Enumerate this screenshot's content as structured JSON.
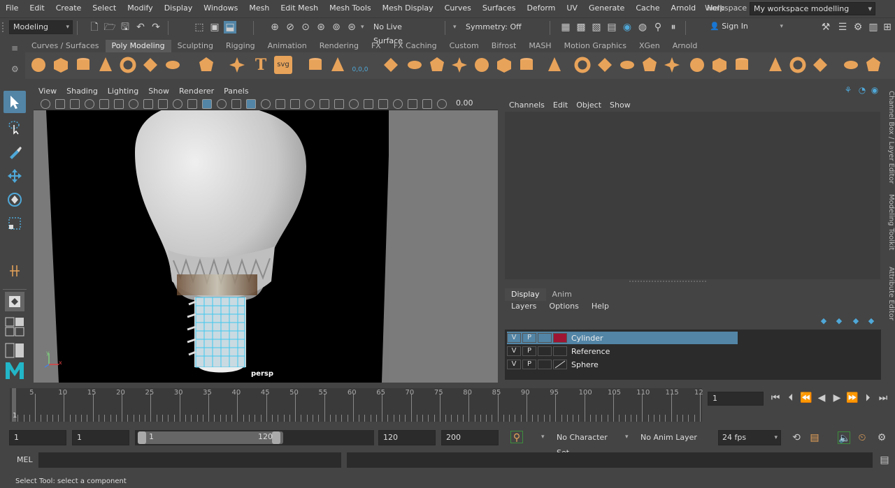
{
  "menu": [
    "File",
    "Edit",
    "Create",
    "Select",
    "Modify",
    "Display",
    "Windows",
    "Mesh",
    "Edit Mesh",
    "Mesh Tools",
    "Mesh Display",
    "Curves",
    "Surfaces",
    "Deform",
    "UV",
    "Generate",
    "Cache",
    "Arnold",
    "Help"
  ],
  "workspace": {
    "label": "Workspace :",
    "value": "My workspace modelling"
  },
  "statusline": {
    "menuset": "Modeling",
    "live_surface": "No Live Surface",
    "symmetry": "Symmetry: Off",
    "sign_in": "Sign In"
  },
  "shelf_tabs": [
    "Curves / Surfaces",
    "Poly Modeling",
    "Sculpting",
    "Rigging",
    "Animation",
    "Rendering",
    "FX",
    "FX Caching",
    "Custom",
    "Bifrost",
    "MASH",
    "Motion Graphics",
    "XGen",
    "Arnold"
  ],
  "shelf_active": "Poly Modeling",
  "shelf_text_icons": {
    "text_tool": "T",
    "svg_tool": "svg",
    "coords": "0,0,0"
  },
  "viewport": {
    "menus": [
      "View",
      "Shading",
      "Lighting",
      "Show",
      "Renderer",
      "Panels"
    ],
    "value_field": "0.00",
    "camera_label": "persp",
    "axis_y": "y",
    "axis_x": "x"
  },
  "channel_box": {
    "menus": [
      "Channels",
      "Edit",
      "Object",
      "Show"
    ]
  },
  "side_tabs": [
    "Channel Box / Layer Editor",
    "Modeling Toolkit",
    "Attribute Editor"
  ],
  "layer_editor": {
    "tabs": [
      "Display",
      "Anim"
    ],
    "menus": [
      "Layers",
      "Options",
      "Help"
    ],
    "layers": [
      {
        "v": "V",
        "p": "P",
        "name": "Cylinder",
        "color": "#9e1533",
        "selected": true
      },
      {
        "v": "V",
        "p": "P",
        "name": "Reference",
        "color": "",
        "selected": false
      },
      {
        "v": "V",
        "p": "P",
        "name": "Sphere",
        "color": "",
        "selected": false
      }
    ]
  },
  "timeline": {
    "ticks": [
      "5",
      "10",
      "15",
      "20",
      "25",
      "30",
      "35",
      "40",
      "45",
      "50",
      "55",
      "60",
      "65",
      "70",
      "75",
      "80",
      "85",
      "90",
      "95",
      "100",
      "105",
      "110",
      "115",
      "12"
    ],
    "current_frame_marker": "1",
    "current_frame": "1"
  },
  "range": {
    "start": "1",
    "playback_start": "1",
    "slider_start": "1",
    "slider_end": "120",
    "playback_end": "120",
    "end": "200",
    "character_set": "No Character Set",
    "anim_layer": "No Anim Layer",
    "fps": "24 fps"
  },
  "cmdline": {
    "label": "MEL"
  },
  "helpline": "Select Tool: select a component",
  "colors": {
    "accent": "#5285a6",
    "shelf_icon": "#e8a35a",
    "layer_cylinder": "#9e1533"
  }
}
